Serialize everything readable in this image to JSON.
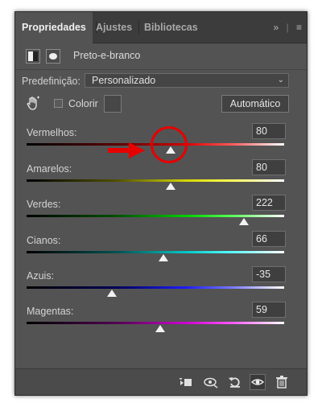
{
  "tabs": [
    {
      "label": "Propriedades",
      "active": true
    },
    {
      "label": "Ajustes",
      "active": false
    },
    {
      "label": "Bibliotecas",
      "active": false
    }
  ],
  "tabbar_icons": [
    "double-chevron-icon",
    "menu-icon"
  ],
  "header": {
    "title": "Preto-e-branco",
    "icons": [
      "adjustment-icon",
      "mask-icon"
    ]
  },
  "preset": {
    "label": "Predefinição:",
    "value": "Personalizado"
  },
  "controls": {
    "colorir_label": "Colorir",
    "colorir_checked": false,
    "auto_label": "Automático",
    "hand_icon": "targeted-adjustment-hand-icon"
  },
  "sliders": [
    {
      "label": "Vermelhos:",
      "value": "80",
      "color": "#ff0000"
    },
    {
      "label": "Amarelos:",
      "value": "80",
      "color": "#ffff00"
    },
    {
      "label": "Verdes:",
      "value": "222",
      "color": "#00ff00"
    },
    {
      "label": "Cianos:",
      "value": "66",
      "color": "#00ffff"
    },
    {
      "label": "Azuis:",
      "value": "-35",
      "color": "#0000ff"
    },
    {
      "label": "Magentas:",
      "value": "59",
      "color": "#ff00ff"
    }
  ],
  "slider_range": [
    -200,
    300
  ],
  "footer_icons": [
    "clip-to-layer-icon",
    "view-previous-state-icon",
    "reset-icon",
    "visibility-eye-icon",
    "trash-icon"
  ],
  "annotation": {
    "color": "#e60000",
    "target": "Vermelhos slider thumb"
  }
}
